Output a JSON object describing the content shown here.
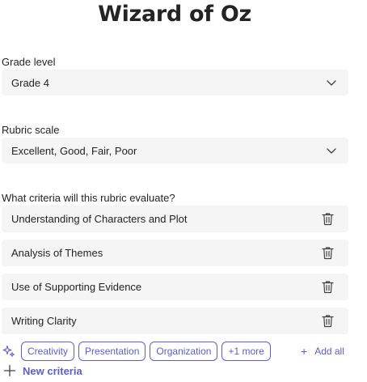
{
  "page": {
    "title": "Wizard of Oz"
  },
  "grade": {
    "label": "Grade level",
    "value": "Grade 4",
    "icon": "chevron-down-icon"
  },
  "rubric": {
    "label": "Rubric scale",
    "value": "Excellent, Good, Fair, Poor",
    "icon": "chevron-down-icon"
  },
  "criteria": {
    "label": "What criteria will this rubric evaluate?",
    "items": [
      {
        "text": "Understanding of Characters and Plot",
        "icon": "trash-icon"
      },
      {
        "text": "Analysis of Themes",
        "icon": "trash-icon"
      },
      {
        "text": "Use of Supporting Evidence",
        "icon": "trash-icon"
      },
      {
        "text": "Writing Clarity",
        "icon": "trash-icon"
      }
    ]
  },
  "suggestions": {
    "icon": "sparkle-icon",
    "chips": [
      "Creativity",
      "Presentation",
      "Organization",
      "+1 more"
    ],
    "add_all": "Add all"
  },
  "new_criteria": {
    "label": "New criteria",
    "icon": "plus-icon"
  },
  "colors": {
    "accent": "#5b5fc7",
    "field_bg": "#f5f5f5",
    "text": "#242424"
  }
}
